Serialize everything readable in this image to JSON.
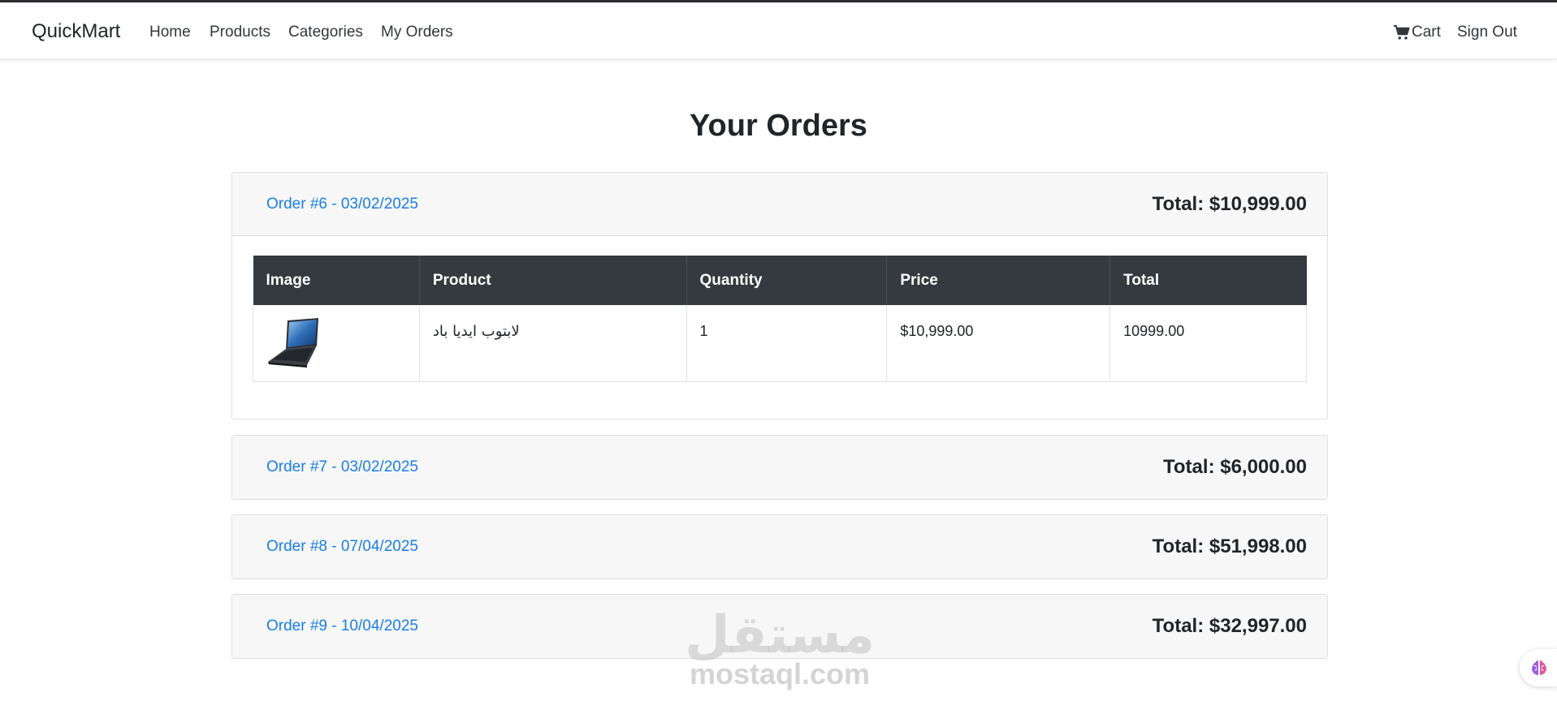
{
  "navbar": {
    "brand": "QuickMart",
    "links": [
      "Home",
      "Products",
      "Categories",
      "My Orders"
    ],
    "cart_label": "Cart",
    "signout_label": "Sign Out"
  },
  "page": {
    "title": "Your Orders"
  },
  "orders": [
    {
      "link": "Order #6 - 03/02/2025",
      "total": "Total: $10,999.00",
      "expanded": true,
      "table": {
        "headers": [
          "Image",
          "Product",
          "Quantity",
          "Price",
          "Total"
        ],
        "rows": [
          {
            "image_icon": "laptop-image",
            "product": "لابتوب ايديا باد",
            "quantity": "1",
            "price": "$10,999.00",
            "total": "10999.00"
          }
        ]
      }
    },
    {
      "link": "Order #7 - 03/02/2025",
      "total": "Total: $6,000.00",
      "expanded": false
    },
    {
      "link": "Order #8 - 07/04/2025",
      "total": "Total: $51,998.00",
      "expanded": false
    },
    {
      "link": "Order #9 - 10/04/2025",
      "total": "Total: $32,997.00",
      "expanded": false
    }
  ],
  "watermark": {
    "arabic": "مستقل",
    "latin": "mostaql.com"
  },
  "icons": {
    "cart": "cart-icon",
    "floating": "brain-icon"
  },
  "colors": {
    "link": "#1a7ee6",
    "table_header_bg": "#343a40",
    "card_header_bg": "#f7f7f7"
  }
}
